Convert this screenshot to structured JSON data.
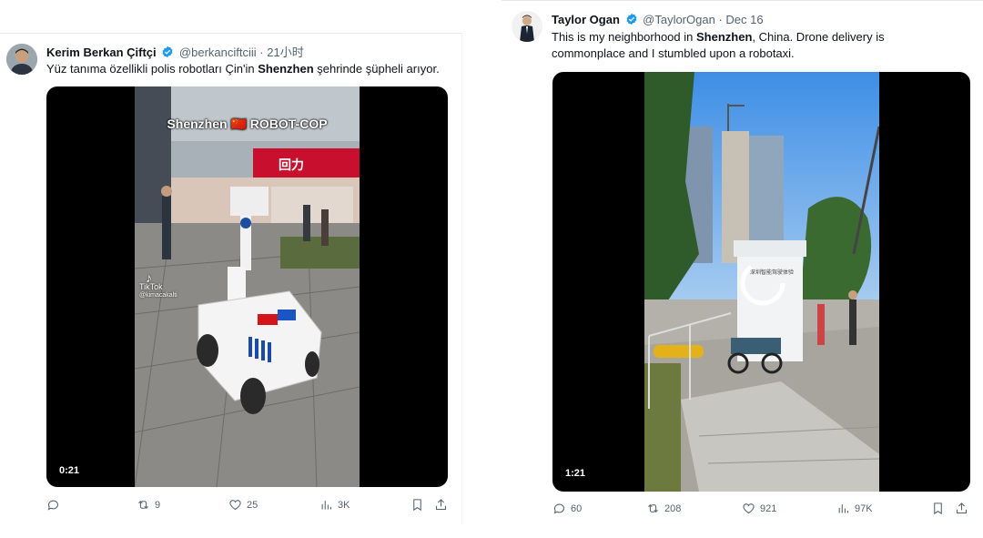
{
  "tweets": [
    {
      "author_name": "Kerim Berkan Çiftçi",
      "handle": "@berkanciftciii",
      "separator": "·",
      "time": "21小时",
      "text_pre": "Yüz tanıma özellikli polis robotları Çin'in ",
      "text_bold": "Shenzhen",
      "text_post": " şehrinde şüpheli arıyor.",
      "video_overlay_text": "Shenzhen 🇨🇳 ROBOT-COP",
      "store_sign": "回力",
      "tiktok_label": "TikTok",
      "tiktok_handle": "@kimacakalti",
      "duration": "0:21",
      "reply_count": "",
      "retweet_count": "9",
      "like_count": "25",
      "views_count": "3K"
    },
    {
      "author_name": "Taylor Ogan",
      "handle": "@TaylorOgan",
      "separator": "·",
      "time": "Dec 16",
      "text_pre": "This is my neighborhood in ",
      "text_bold": "Shenzhen",
      "text_post": ", China. Drone delivery is commonplace and I stumbled upon a robotaxi.",
      "kiosk_sign": "深圳智能驾驶体验",
      "duration": "1:21",
      "reply_count": "60",
      "retweet_count": "208",
      "like_count": "921",
      "views_count": "97K"
    }
  ],
  "icons": [
    "reply-icon",
    "retweet-icon",
    "like-icon",
    "views-icon",
    "bookmark-icon",
    "share-icon",
    "verified-badge-icon"
  ],
  "colors": {
    "verified": "#1d9bf0",
    "muted": "#536471",
    "text": "#0f1419"
  }
}
